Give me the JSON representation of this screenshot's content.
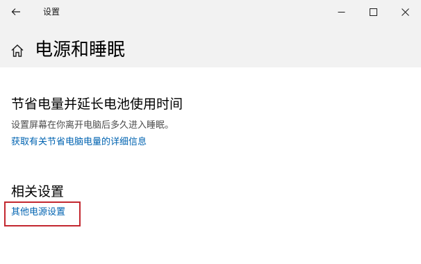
{
  "window": {
    "title": "设置"
  },
  "header": {
    "page_title": "电源和睡眠"
  },
  "sections": {
    "battery": {
      "heading": "节省电量并延长电池使用时间",
      "description": "设置屏幕在你离开电脑后多久进入睡眠。",
      "link": "获取有关节省电脑电量的详细信息"
    },
    "related": {
      "heading": "相关设置",
      "link": "其他电源设置"
    }
  },
  "icons": {
    "back": "back-arrow-icon",
    "minimize": "minimize-icon",
    "maximize": "maximize-icon",
    "close": "close-icon",
    "home": "home-icon"
  },
  "colors": {
    "header_bg": "#f2f2f2",
    "content_bg": "#ffffff",
    "link": "#0063b1",
    "highlight": "#c3272f"
  }
}
